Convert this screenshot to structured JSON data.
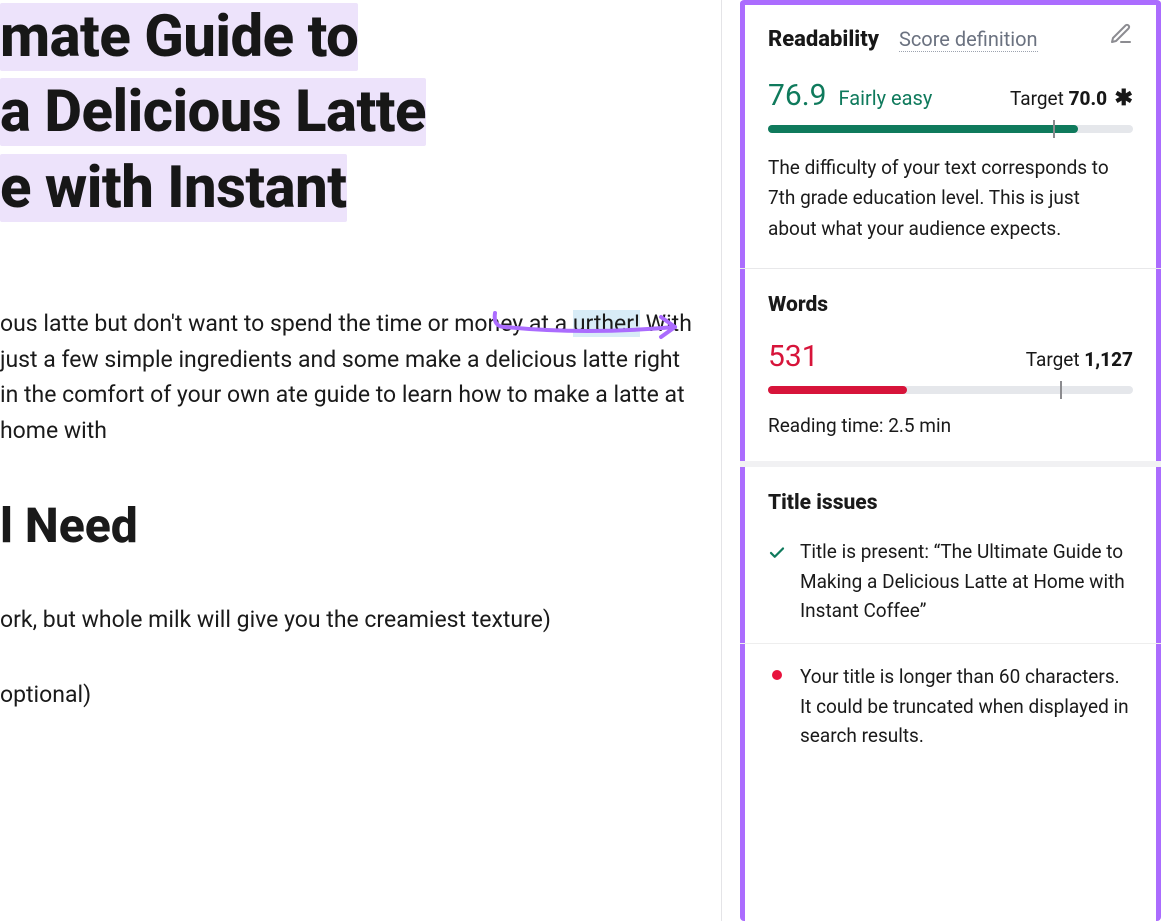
{
  "editor": {
    "title_line1": "mate Guide to",
    "title_line2": "a Delicious Latte",
    "title_line3": "e with Instant",
    "para_before_mark": "ous latte but don't want to spend the time or money at a ",
    "para_mark": "urther!",
    "para_after_mark": " With just a few simple ingredients and some make a delicious latte right in the comfort of your own ate guide to learn how to make a latte at home with",
    "h2": "l Need",
    "bullet1": "ork, but whole milk will give you the creamiest texture)",
    "bullet2": "optional)"
  },
  "readability": {
    "title": "Readability",
    "score_definition": "Score definition",
    "score": "76.9",
    "score_label": "Fairly easy",
    "target_label": "Target ",
    "target_value": "70.0",
    "description": "The difficulty of your text corresponds to 7th grade education level. This is just about what your audience expects."
  },
  "words": {
    "title": "Words",
    "count": "531",
    "target_label": "Target ",
    "target_value": "1,127",
    "reading_time": "Reading time: 2.5 min"
  },
  "title_issues": {
    "title": "Title issues",
    "ok_text": "Title is present: “The Ultimate Guide to Making a Delicious Latte at Home with Instant Coffee”",
    "warn_text": "Your title is longer than 60 characters. It could be truncated when displayed in search results."
  }
}
